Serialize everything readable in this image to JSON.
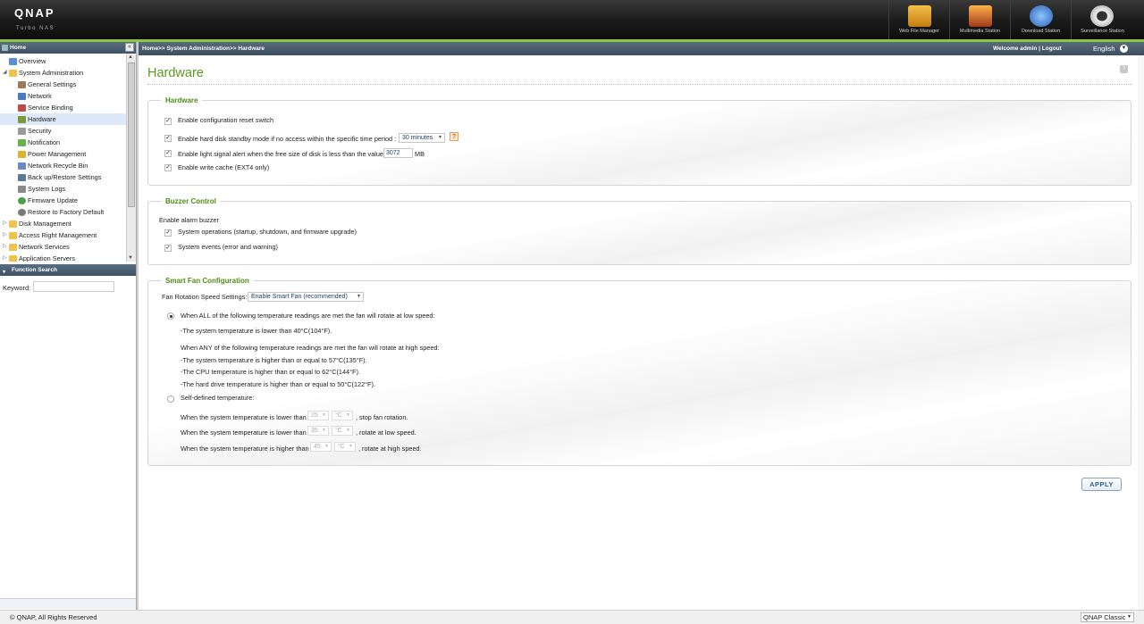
{
  "header": {
    "logo": "QNAP",
    "logo_sub": "Turbo NAS",
    "apps": [
      {
        "label": "Web File Manager",
        "color": "#e0a028"
      },
      {
        "label": "Multimedia Station",
        "color": "#c95a2a"
      },
      {
        "label": "Download Station",
        "color": "#3d7fd0"
      },
      {
        "label": "Surveillance Station",
        "color": "#d8d8d8"
      }
    ]
  },
  "sidebar": {
    "home_label": "Home",
    "collapse_label": "«",
    "items": [
      {
        "label": "Overview",
        "icon": "overview-icon",
        "color": "#5a8fd0"
      },
      {
        "label": "System Administration",
        "icon": "folder-open-icon",
        "color": "#f2c14e",
        "expander": "◢"
      },
      {
        "label": "General Settings",
        "icon": "gear-icon",
        "color": "#9b7b5a"
      },
      {
        "label": "Network",
        "icon": "network-icon",
        "color": "#4a7ac0"
      },
      {
        "label": "Service Binding",
        "icon": "service-icon",
        "color": "#c04a4a"
      },
      {
        "label": "Hardware",
        "icon": "hardware-icon",
        "color": "#7a9a3a"
      },
      {
        "label": "Security",
        "icon": "lock-icon",
        "color": "#9a9a9a"
      },
      {
        "label": "Notification",
        "icon": "notification-icon",
        "color": "#6ab04a"
      },
      {
        "label": "Power Management",
        "icon": "power-icon",
        "color": "#e0b030"
      },
      {
        "label": "Network Recycle Bin",
        "icon": "recycle-bin-icon",
        "color": "#6a8ac0"
      },
      {
        "label": "Back up/Restore Settings",
        "icon": "backup-icon",
        "color": "#5a7a9a"
      },
      {
        "label": "System Logs",
        "icon": "logs-icon",
        "color": "#8a8a8a"
      },
      {
        "label": "Firmware Update",
        "icon": "firmware-icon",
        "color": "#4aa04a"
      },
      {
        "label": "Restore to Factory Default",
        "icon": "restore-icon",
        "color": "#7a7a7a"
      },
      {
        "label": "Disk Management",
        "icon": "folder-icon",
        "color": "#f2c14e",
        "expander": "▷"
      },
      {
        "label": "Access Right Management",
        "icon": "folder-icon",
        "color": "#f2c14e",
        "expander": "▷"
      },
      {
        "label": "Network Services",
        "icon": "folder-icon",
        "color": "#f2c14e",
        "expander": "▷"
      },
      {
        "label": "Application Servers",
        "icon": "folder-icon",
        "color": "#f2c14e",
        "expander": "▷"
      }
    ],
    "function_search": {
      "title": "Function Search",
      "keyword_label": "Keyword:",
      "keyword_value": ""
    }
  },
  "topnav": {
    "breadcrumb": "Home>> System Administration>> Hardware",
    "welcome": "Welcome admin | Logout",
    "language": "English"
  },
  "page": {
    "title": "Hardware",
    "hardware": {
      "legend": "Hardware",
      "reset_switch": "Enable configuration reset switch",
      "standby": "Enable hard disk standby mode if no access within the specific time period :",
      "standby_period": "30 minutes",
      "light_alert": "Enable light signal alert when the free size of disk is less than the value:",
      "light_value": "3072",
      "light_unit": "MB",
      "write_cache": "Enable write cache (EXT4 only)"
    },
    "buzzer": {
      "legend": "Buzzer Control",
      "intro": "Enable alarm buzzer",
      "system_ops": "System operations (startup, shutdown, and firmware upgrade)",
      "system_events": "System events (error and warning)"
    },
    "fan": {
      "legend": "Smart Fan Configuration",
      "speed_label": "Fan Rotation Speed Settings:",
      "speed_value": "Enable Smart Fan (recommended)",
      "all_rule": "When ALL of the following temperature readings are met the fan will rotate at low speed:",
      "all_1": "-The system temperature is lower than 40°C(104°F).",
      "any_rule": "When ANY of the following temperature readings are met the fan will rotate at high speed:",
      "any_1": "-The system temperature is higher than or equal to 57°C(135°F).",
      "any_2": "-The CPU temperature is higher than or equal to 62°C(144°F).",
      "any_3": "-The hard drive temperature is higher than or equal to 50°C(122°F).",
      "self_defined": "Self-defined temperature:",
      "stop_text": "When the system temperature is lower than",
      "stop_value": "25",
      "stop_unit": "°C",
      "stop_suffix": ", stop fan rotation.",
      "low_text": "When the system temperature is lower than",
      "low_value": "35",
      "low_unit": "°C",
      "low_suffix": ", rotate at low speed.",
      "high_text": "When the system temperature is higher than",
      "high_value": "45",
      "high_unit": "°C",
      "high_suffix": ", rotate at high speed."
    },
    "apply": "APPLY"
  },
  "footer": {
    "copyright": "© QNAP, All Rights Reserved",
    "theme": "QNAP Classic"
  }
}
